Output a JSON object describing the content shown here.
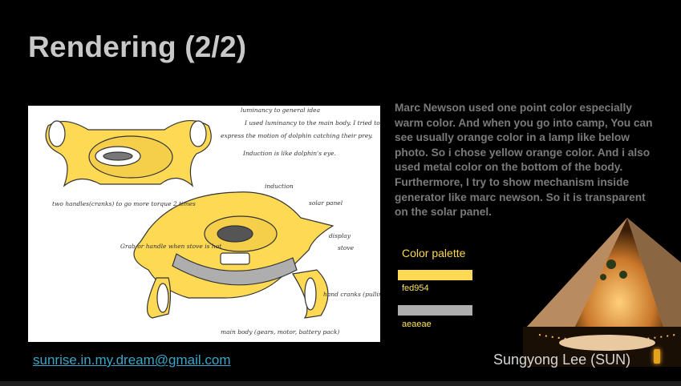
{
  "slide": {
    "title": "Rendering (2/2)",
    "description": "Marc Newson used one point color especially warm color. And when you go into camp, You can see usually orange color in a lamp like below photo. So i chose yellow orange color. And i also used metal color on the bottom of the body. Furthermore, I try to show mechanism inside generator like marc newson. So it is transparent on the solar panel.",
    "palette": {
      "label": "Color palette",
      "colors": [
        {
          "hex": "fed954",
          "color": "#fed954"
        },
        {
          "hex": "aeaeae",
          "color": "#aeaeae"
        }
      ]
    },
    "email": "sunrise.in.my.dream@gmail.com",
    "author": "Sungyong Lee (SUN)"
  },
  "sketch_notes": {
    "note_top_1": "luminancy to general idea",
    "note_top_2": "I used luminancy to the main body. I tried to",
    "note_top_3": "express the motion of dolphin catching their prey.",
    "note_top_4": "Induction is like dolphin's eye.",
    "note_handles": "two handles(cranks) to go more torque 2 times",
    "note_induction": "induction",
    "note_solar": "solar panel",
    "note_grab": "Grab or handle when stove is hot",
    "note_display": "display",
    "note_stove": "stove",
    "note_hand_cranks": "hand cranks (pulling away)",
    "note_main_body": "main body (gears, motor, battery pack)"
  }
}
